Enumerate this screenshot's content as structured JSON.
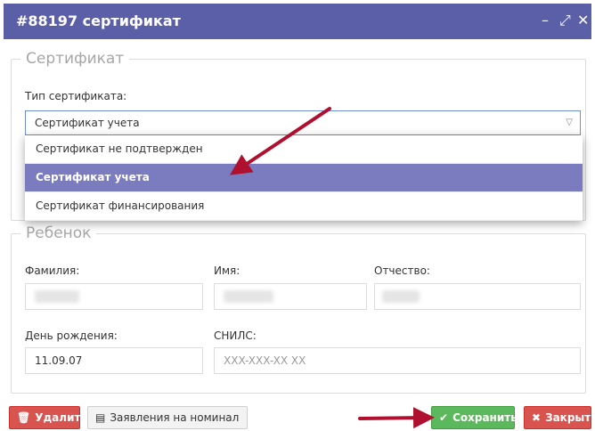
{
  "window": {
    "title": "#88197 сертификат",
    "controls": {
      "minimize": "–",
      "maximize": "⤢",
      "close": "✕"
    }
  },
  "certificate_section": {
    "legend": "Сертификат",
    "type_label": "Тип сертификата:",
    "selected_value": "Сертификат учета",
    "options": [
      {
        "label": "Сертификат не подтвержден",
        "selected": false
      },
      {
        "label": "Сертификат учета",
        "selected": true
      },
      {
        "label": "Сертификат финансирования",
        "selected": false
      }
    ]
  },
  "child_section": {
    "legend": "Ребенок",
    "surname_label": "Фамилия:",
    "name_label": "Имя:",
    "patronymic_label": "Отчество:",
    "birthdate_label": "День рождения:",
    "birthdate_value": "11.09.07",
    "snils_label": "СНИЛС:",
    "snils_placeholder": "XXX-XXX-XX XX"
  },
  "footer": {
    "delete_label": "Удалить",
    "applications_label": "Заявления на номинал",
    "save_label": "Сохранить",
    "close_label": "Закрыть"
  },
  "colors": {
    "titlebar": "#5a5fa8",
    "selected_option": "#7b7cbf",
    "delete": "#d9534f",
    "save": "#5cb85c",
    "annotation_arrow": "#b01030"
  },
  "icons": {
    "delete": "trash-icon",
    "applications": "document-icon",
    "save": "check-icon",
    "close": "x-icon",
    "select": "caret-down-icon"
  }
}
